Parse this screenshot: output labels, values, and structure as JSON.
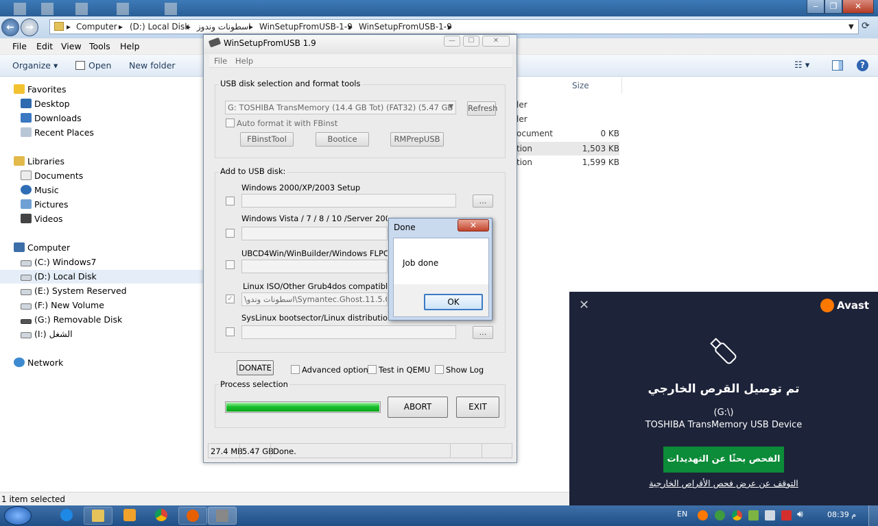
{
  "explorer": {
    "breadcrumbs": [
      "Computer",
      "(D:) Local Disk",
      "اسطونات وندوز",
      "WinSetupFromUSB-1-9",
      "WinSetupFromUSB-1-9"
    ],
    "menu": [
      "File",
      "Edit",
      "View",
      "Tools",
      "Help"
    ],
    "toolbar": {
      "organize": "Organize",
      "open": "Open",
      "new_folder": "New folder"
    },
    "nav": {
      "favorites": "Favorites",
      "favorites_items": [
        "Desktop",
        "Downloads",
        "Recent Places"
      ],
      "libraries": "Libraries",
      "libraries_items": [
        "Documents",
        "Music",
        "Pictures",
        "Videos"
      ],
      "computer": "Computer",
      "drives": [
        "(C:) Windows7",
        "(D:) Local Disk",
        "(E:) System Reserved",
        "(F:) New Volume",
        "(G:) Removable Disk",
        "(I:) الشغل"
      ],
      "network": "Network"
    },
    "columns": {
      "size": "Size"
    },
    "rows": [
      {
        "type": "ler",
        "size": ""
      },
      {
        "type": "ler",
        "size": ""
      },
      {
        "type": "ocument",
        "size": "0 KB"
      },
      {
        "type": "tion",
        "size": "1,503 KB"
      },
      {
        "type": "tion",
        "size": "1,599 KB"
      }
    ],
    "status": "1 item selected"
  },
  "wsu": {
    "title": "WinSetupFromUSB 1.9",
    "menu": [
      "File",
      "Help"
    ],
    "usb_group_label": "USB disk selection and format tools",
    "disk_select": "G: TOSHIBA TransMemory (14.4 GB Tot) (FAT32) (5.47 GB Free)",
    "refresh": "Refresh",
    "auto_format": "Auto format it with FBinst",
    "fbinst": "FBinstTool",
    "bootice": "Bootice",
    "rmprep": "RMPrepUSB",
    "add_group_label": "Add to USB disk:",
    "entries": [
      {
        "label": "Windows 2000/XP/2003 Setup",
        "path": ""
      },
      {
        "label": "Windows Vista / 7 / 8 / 10 /Server 2008/2012 based ISO",
        "path": ""
      },
      {
        "label": "UBCD4Win/WinBuilder/Windows FLPC setup",
        "path": ""
      },
      {
        "label": "Linux ISO/Other Grub4dos compatible ISO",
        "path": "\\اسطونات وندو\\Symantec.Ghost.11.5.Corpora"
      },
      {
        "label": "SysLinux bootsector/Linux distribution using S",
        "path": ""
      }
    ],
    "browse": "...",
    "donate": "DONATE",
    "advanced": "Advanced options",
    "qemu": "Test in QEMU",
    "showlog": "Show Log",
    "process_label": "Process selection",
    "progress": 1.0,
    "abort": "ABORT",
    "exit": "EXIT",
    "status": [
      "27.4 MB",
      "5.47 GB",
      "Done."
    ]
  },
  "done_dialog": {
    "title": "Done",
    "message": "Job done",
    "ok": "OK"
  },
  "avast": {
    "brand": "Avast",
    "heading": "تم توصيل القرص الخارجي",
    "drive": "(G:\\)",
    "device": "TOSHIBA TransMemory USB Device",
    "scan_button": "الفحص بحثًا عن التهديدات",
    "stop_link": "التوقف عن عرض فحص الأقراص الخارجية",
    "accent": "#0c8b38"
  },
  "taskbar": {
    "lang": "EN",
    "time": "08:39 م"
  }
}
